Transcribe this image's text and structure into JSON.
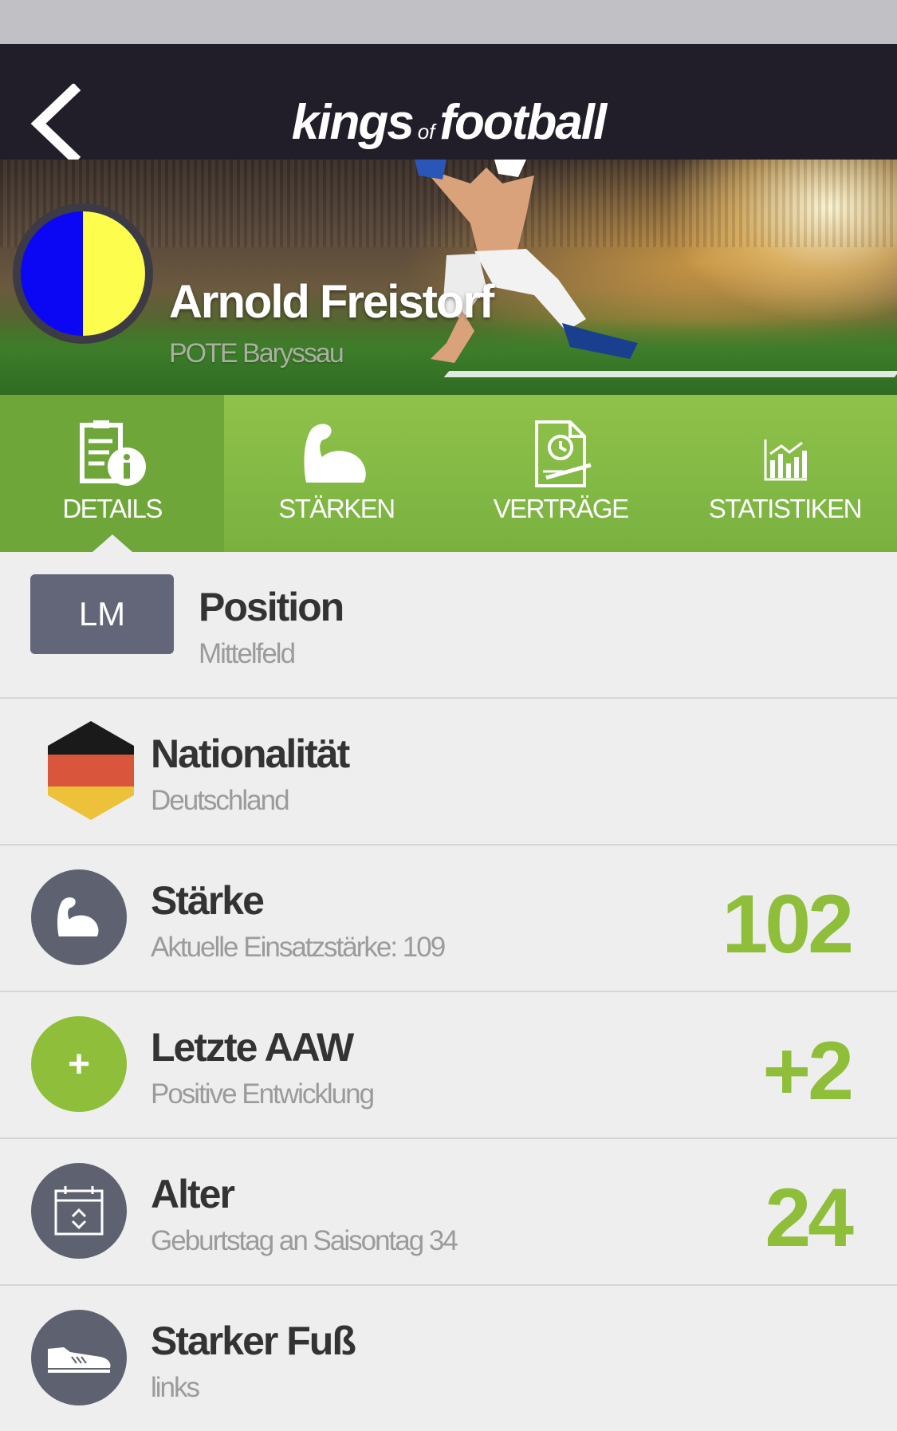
{
  "app": {
    "logo_left": "kings",
    "logo_of": "of",
    "logo_right": "football"
  },
  "player": {
    "name": "Arnold Freistorf",
    "club": "POTE Baryssau",
    "club_colors": [
      "#0b07f5",
      "#fdfd4e"
    ]
  },
  "tabs": [
    {
      "label": "DETAILS",
      "icon": "details-info-icon",
      "active": true
    },
    {
      "label": "STÄRKEN",
      "icon": "biceps-icon",
      "active": false
    },
    {
      "label": "VERTRÄGE",
      "icon": "contract-clock-icon",
      "active": false
    },
    {
      "label": "STATISTIKEN",
      "icon": "bar-chart-icon",
      "active": false
    }
  ],
  "details": {
    "position": {
      "badge": "LM",
      "title": "Position",
      "subtitle": "Mittelfeld"
    },
    "nationality": {
      "title": "Nationalität",
      "subtitle": "Deutschland",
      "icon": "germany-flag-icon"
    },
    "strength": {
      "title": "Stärke",
      "subtitle": "Aktuelle Einsatzstärke: 109",
      "value": "102",
      "icon": "biceps-icon"
    },
    "last_aaw": {
      "title": "Letzte AAW",
      "subtitle": "Positive Entwicklung",
      "value": "+2",
      "icon_text": "+"
    },
    "age": {
      "title": "Alter",
      "subtitle": "Geburtstag an Saisontag 34",
      "value": "24",
      "icon": "calendar-icon"
    },
    "foot": {
      "title": "Starker Fuß",
      "subtitle": "links",
      "icon": "football-boot-icon"
    }
  },
  "colors": {
    "accent_green": "#8fbf3a",
    "navbar": "#211e29",
    "icon_gray": "#5e6270"
  }
}
